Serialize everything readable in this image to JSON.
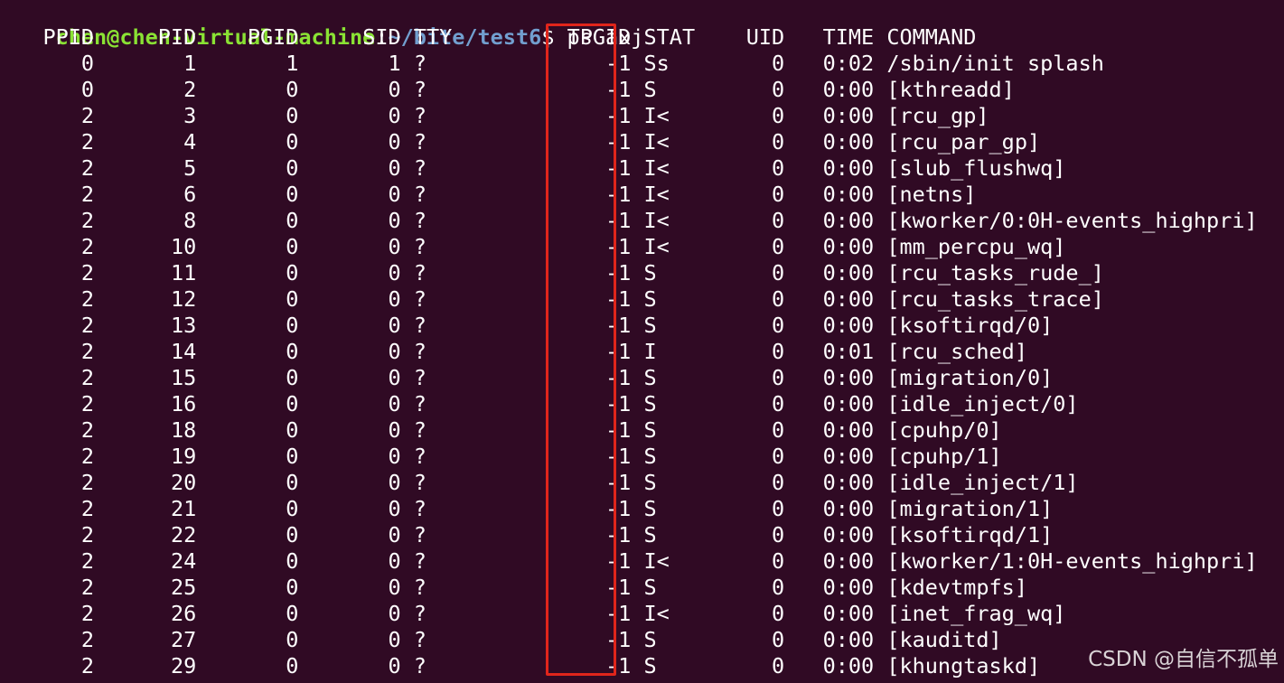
{
  "prompt": {
    "user_host": "chen@chen-virtual-machine",
    "sep": ":",
    "path": "~/bite/test6",
    "suffix": "$ ",
    "command": "ps axj"
  },
  "columns": [
    "PPID",
    "PID",
    "PGID",
    "SID",
    "TTY",
    "TPGID",
    "STAT",
    "UID",
    "TIME",
    "COMMAND"
  ],
  "rows": [
    [
      "0",
      "1",
      "1",
      "1",
      "?",
      "-1",
      "Ss",
      "0",
      "0:02",
      "/sbin/init splash"
    ],
    [
      "0",
      "2",
      "0",
      "0",
      "?",
      "-1",
      "S",
      "0",
      "0:00",
      "[kthreadd]"
    ],
    [
      "2",
      "3",
      "0",
      "0",
      "?",
      "-1",
      "I<",
      "0",
      "0:00",
      "[rcu_gp]"
    ],
    [
      "2",
      "4",
      "0",
      "0",
      "?",
      "-1",
      "I<",
      "0",
      "0:00",
      "[rcu_par_gp]"
    ],
    [
      "2",
      "5",
      "0",
      "0",
      "?",
      "-1",
      "I<",
      "0",
      "0:00",
      "[slub_flushwq]"
    ],
    [
      "2",
      "6",
      "0",
      "0",
      "?",
      "-1",
      "I<",
      "0",
      "0:00",
      "[netns]"
    ],
    [
      "2",
      "8",
      "0",
      "0",
      "?",
      "-1",
      "I<",
      "0",
      "0:00",
      "[kworker/0:0H-events_highpri]"
    ],
    [
      "2",
      "10",
      "0",
      "0",
      "?",
      "-1",
      "I<",
      "0",
      "0:00",
      "[mm_percpu_wq]"
    ],
    [
      "2",
      "11",
      "0",
      "0",
      "?",
      "-1",
      "S",
      "0",
      "0:00",
      "[rcu_tasks_rude_]"
    ],
    [
      "2",
      "12",
      "0",
      "0",
      "?",
      "-1",
      "S",
      "0",
      "0:00",
      "[rcu_tasks_trace]"
    ],
    [
      "2",
      "13",
      "0",
      "0",
      "?",
      "-1",
      "S",
      "0",
      "0:00",
      "[ksoftirqd/0]"
    ],
    [
      "2",
      "14",
      "0",
      "0",
      "?",
      "-1",
      "I",
      "0",
      "0:01",
      "[rcu_sched]"
    ],
    [
      "2",
      "15",
      "0",
      "0",
      "?",
      "-1",
      "S",
      "0",
      "0:00",
      "[migration/0]"
    ],
    [
      "2",
      "16",
      "0",
      "0",
      "?",
      "-1",
      "S",
      "0",
      "0:00",
      "[idle_inject/0]"
    ],
    [
      "2",
      "18",
      "0",
      "0",
      "?",
      "-1",
      "S",
      "0",
      "0:00",
      "[cpuhp/0]"
    ],
    [
      "2",
      "19",
      "0",
      "0",
      "?",
      "-1",
      "S",
      "0",
      "0:00",
      "[cpuhp/1]"
    ],
    [
      "2",
      "20",
      "0",
      "0",
      "?",
      "-1",
      "S",
      "0",
      "0:00",
      "[idle_inject/1]"
    ],
    [
      "2",
      "21",
      "0",
      "0",
      "?",
      "-1",
      "S",
      "0",
      "0:00",
      "[migration/1]"
    ],
    [
      "2",
      "22",
      "0",
      "0",
      "?",
      "-1",
      "S",
      "0",
      "0:00",
      "[ksoftirqd/1]"
    ],
    [
      "2",
      "24",
      "0",
      "0",
      "?",
      "-1",
      "I<",
      "0",
      "0:00",
      "[kworker/1:0H-events_highpri]"
    ],
    [
      "2",
      "25",
      "0",
      "0",
      "?",
      "-1",
      "S",
      "0",
      "0:00",
      "[kdevtmpfs]"
    ],
    [
      "2",
      "26",
      "0",
      "0",
      "?",
      "-1",
      "I<",
      "0",
      "0:00",
      "[inet_frag_wq]"
    ],
    [
      "2",
      "27",
      "0",
      "0",
      "?",
      "-1",
      "S",
      "0",
      "0:00",
      "[kauditd]"
    ],
    [
      "2",
      "29",
      "0",
      "0",
      "?",
      "-1",
      "S",
      "0",
      "0:00",
      "[khungtaskd]"
    ]
  ],
  "watermark": "CSDN @自信不孤单",
  "colors": {
    "background": "#300a24",
    "user_host": "#8ae234",
    "path": "#729fcf",
    "highlight_box": "#e0251b"
  }
}
